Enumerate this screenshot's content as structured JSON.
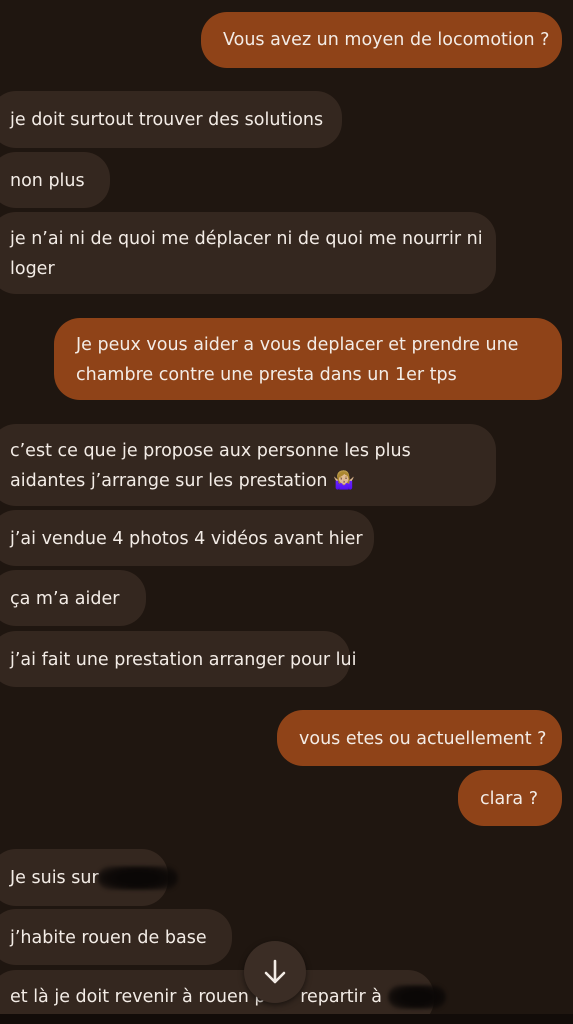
{
  "messages": [
    {
      "side": "sent",
      "text": "Vous avez un moyen de locomotion ?"
    },
    {
      "side": "received",
      "text": "je doit surtout trouver des solutions"
    },
    {
      "side": "received",
      "text": "non plus"
    },
    {
      "side": "received",
      "line1": "je n’ai ni de quoi me déplacer ni de quoi me nourrir ni",
      "line2": "loger"
    },
    {
      "side": "sent",
      "line1": "Je peux vous aider a vous deplacer et prendre une",
      "line2": "chambre contre une presta dans un 1er tps"
    },
    {
      "side": "received",
      "line1": "c’est ce que je propose aux personne les plus",
      "line2": "aidantes j’arrange sur les prestation",
      "emoji": "🤷🏼‍♀️"
    },
    {
      "side": "received",
      "text": "j’ai vendue 4 photos 4 vidéos avant hier"
    },
    {
      "side": "received",
      "text": "ça m’a aider"
    },
    {
      "side": "received",
      "text": "j’ai fait une prestation arranger pour lui"
    },
    {
      "side": "sent",
      "text": "vous etes ou actuellement ?"
    },
    {
      "side": "sent",
      "text": "clara ?"
    },
    {
      "side": "received",
      "text": "Je suis sur",
      "redacted": true
    },
    {
      "side": "received",
      "text": "j’habite rouen de base"
    },
    {
      "side": "received",
      "text_a": "et là je doit revenir à rouen po",
      "text_b": "repartir à",
      "redacted": true
    }
  ],
  "scroll_button": {
    "icon": "arrow-down-icon"
  }
}
